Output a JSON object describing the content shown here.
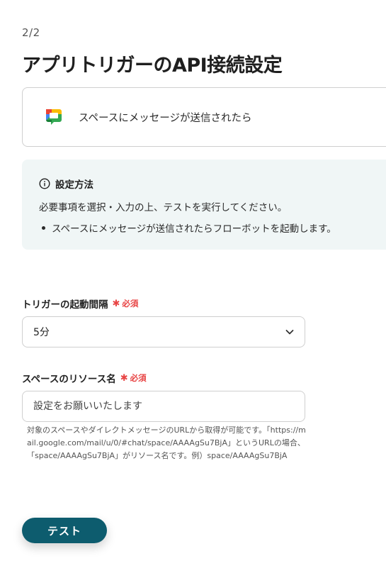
{
  "header": {
    "step": "2/2",
    "title": "アプリトリガーのAPI接続設定"
  },
  "app_card": {
    "icon": "google-chat-icon",
    "label": "スペースにメッセージが送信されたら"
  },
  "info": {
    "icon": "info-circle-icon",
    "heading": "設定方法",
    "text": "必要事項を選択・入力の上、テストを実行してください。",
    "bullets": [
      "スペースにメッセージが送信されたらフローボットを起動します。"
    ]
  },
  "fields": {
    "interval": {
      "label": "トリガーの起動間隔",
      "required": "必須",
      "value": "5分"
    },
    "space_name": {
      "label": "スペースのリソース名",
      "required": "必須",
      "placeholder": "設定をお願いいたします",
      "value": "",
      "help": "対象のスペースやダイレクトメッセージのURLから取得が可能です。「https://mail.google.com/mail/u/0/#chat/space/AAAAgSu7BjA」というURLの場合、「space/AAAAgSu7BjA」がリソース名です。例）space/AAAAgSu7BjA"
    }
  },
  "actions": {
    "test_label": "テスト"
  },
  "colors": {
    "primary_button": "#0d5c6e",
    "required": "#e84545",
    "info_background": "#f0f6f6"
  }
}
